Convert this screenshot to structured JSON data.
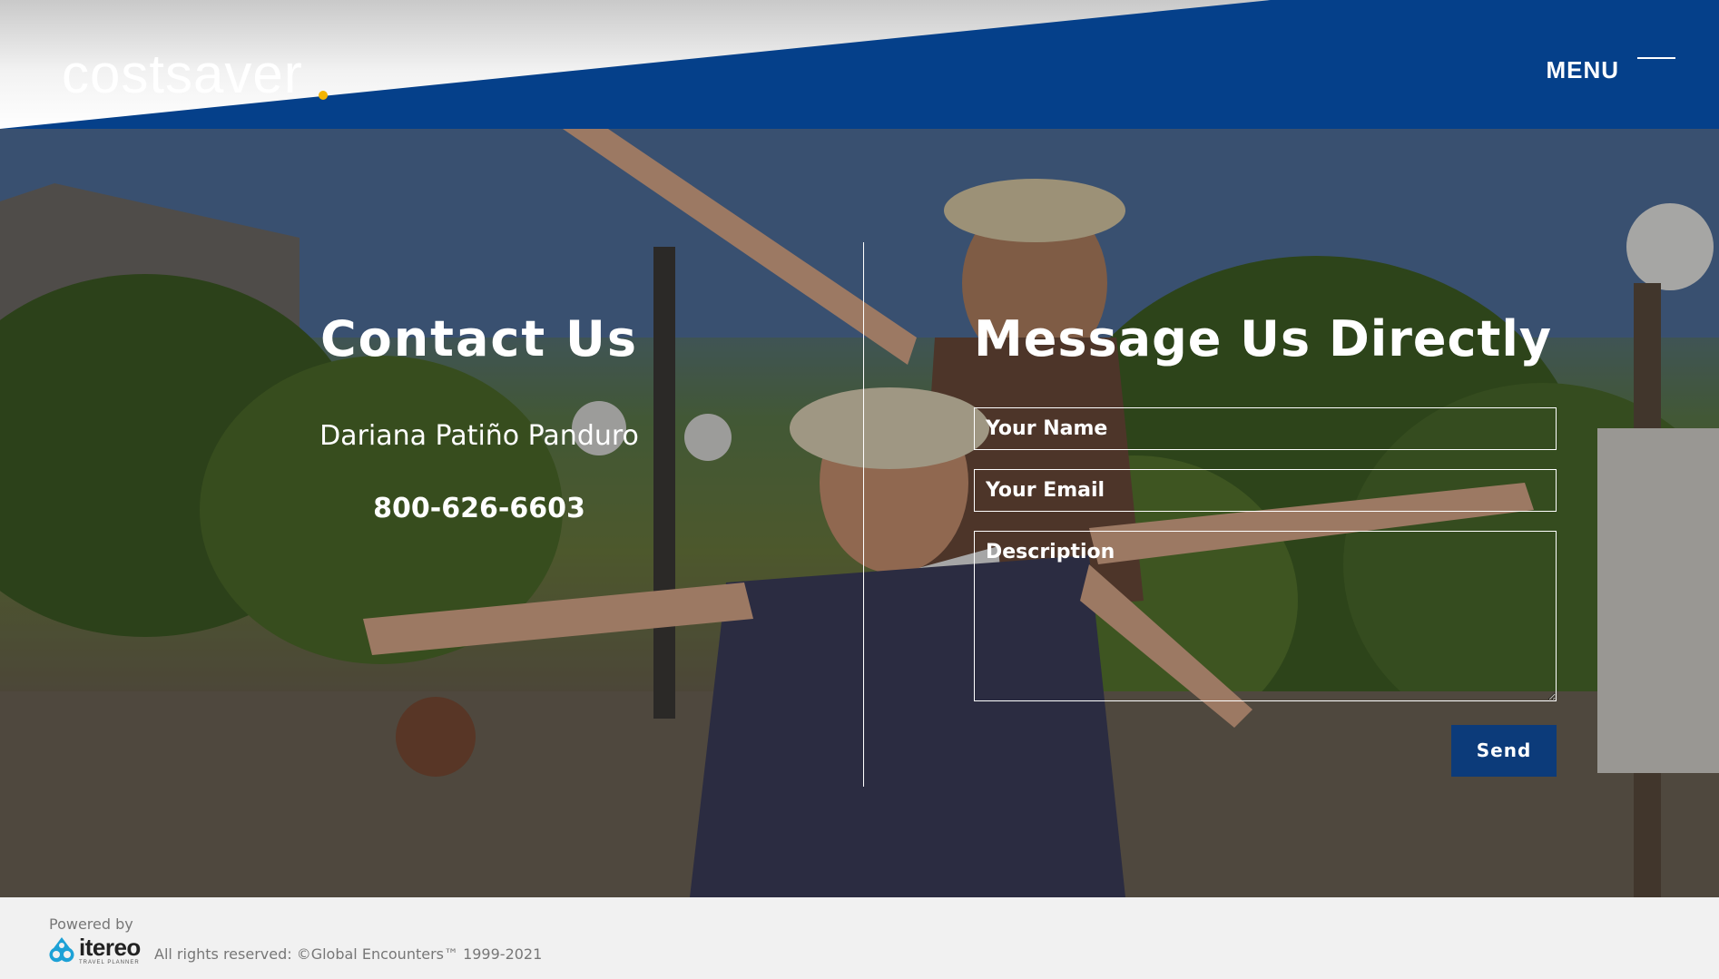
{
  "header": {
    "logo_text": "costsaver",
    "menu_label": "MENU"
  },
  "contact": {
    "title": "Contact Us",
    "name": "Dariana Patiño Panduro",
    "phone": "800-626-6603"
  },
  "form": {
    "title": "Message Us Directly",
    "name_placeholder": "Your Name",
    "email_placeholder": "Your Email",
    "description_placeholder": "Description",
    "send_label": "Send"
  },
  "footer": {
    "powered_by": "Powered by",
    "itereo_word": "itereo",
    "itereo_sub": "TRAVEL PLANNER",
    "copyright": "All rights reserved: ©Global Encounters™ 1999-2021"
  },
  "colors": {
    "header_blue": "#05408a",
    "button_blue": "#0c3b7a",
    "logo_dot": "#f4b400",
    "footer_bg": "#f1f1f1",
    "itereo_teal": "#1da1d6"
  },
  "icons": {
    "menu": "menu-line-icon",
    "itereo": "itereo-logo-icon"
  }
}
